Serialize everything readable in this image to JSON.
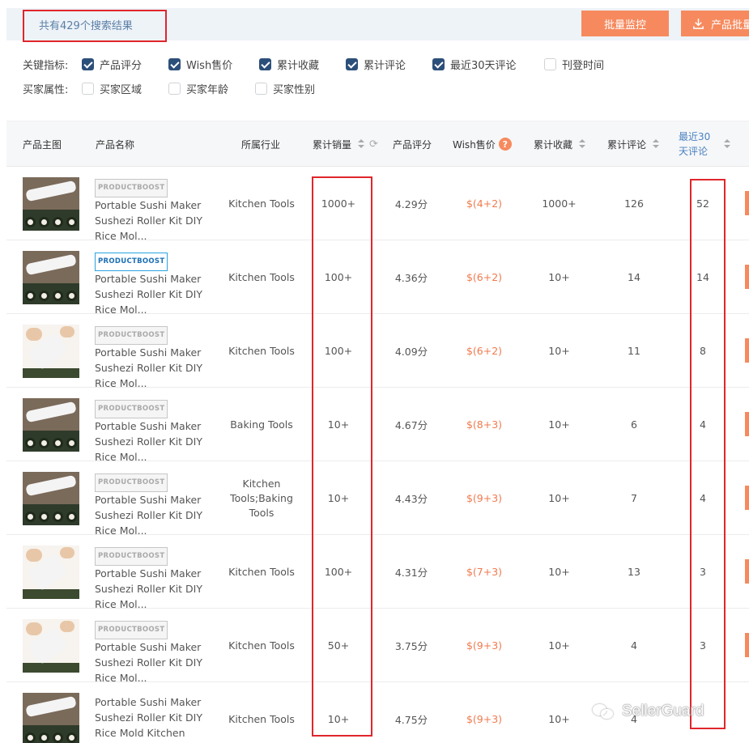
{
  "header": {
    "result_count": "共有429个搜索结果",
    "monitor_button": "批量监控",
    "export_button": "产品批量"
  },
  "filters": {
    "metrics_label": "关键指标:",
    "metrics": [
      {
        "label": "产品评分",
        "checked": true
      },
      {
        "label": "Wish售价",
        "checked": true
      },
      {
        "label": "累计收藏",
        "checked": true
      },
      {
        "label": "累计评论",
        "checked": true
      },
      {
        "label": "最近30天评论",
        "checked": true
      },
      {
        "label": "刊登时间",
        "checked": false
      }
    ],
    "buyer_label": "买家属性:",
    "buyer": [
      {
        "label": "买家区域",
        "checked": false
      },
      {
        "label": "买家年龄",
        "checked": false
      },
      {
        "label": "买家性别",
        "checked": false
      }
    ]
  },
  "columns": {
    "image": "产品主图",
    "name": "产品名称",
    "industry": "所属行业",
    "sales": "累计销量",
    "score": "产品评分",
    "price": "Wish售价",
    "favorites": "累计收藏",
    "reviews": "累计评论",
    "recent_reviews": "最近30天评论"
  },
  "badge_text": "PRODUCTBOOST",
  "rows": [
    {
      "badge": true,
      "badge_highlight": false,
      "name": "Portable Sushi Maker Sushezi Roller Kit DIY Rice Mol...",
      "industry": "Kitchen Tools",
      "sales": "1000+",
      "score": "4.29分",
      "price": "$(4+2)",
      "favorites": "1000+",
      "reviews": "126",
      "recent_reviews": "52",
      "thumb": "sushi"
    },
    {
      "badge": true,
      "badge_highlight": true,
      "name": "Portable Sushi Maker Sushezi Roller Kit DIY Rice Mol...",
      "industry": "Kitchen Tools",
      "sales": "100+",
      "score": "4.36分",
      "price": "$(6+2)",
      "favorites": "10+",
      "reviews": "14",
      "recent_reviews": "14",
      "thumb": "sushi"
    },
    {
      "badge": true,
      "badge_highlight": false,
      "name": "Portable Sushi Maker Sushezi Roller Kit DIY Rice Mol...",
      "industry": "Kitchen Tools",
      "sales": "100+",
      "score": "4.09分",
      "price": "$(6+2)",
      "favorites": "10+",
      "reviews": "11",
      "recent_reviews": "8",
      "thumb": "hands"
    },
    {
      "badge": true,
      "badge_highlight": false,
      "name": "Portable Sushi Maker Sushezi Roller Kit DIY Rice Mol...",
      "industry": "Baking Tools",
      "sales": "10+",
      "score": "4.67分",
      "price": "$(8+3)",
      "favorites": "10+",
      "reviews": "6",
      "recent_reviews": "4",
      "thumb": "sushi"
    },
    {
      "badge": true,
      "badge_highlight": false,
      "name": "Portable Sushi Maker Sushezi Roller Kit DIY Rice Mol...",
      "industry": "Kitchen Tools;Baking Tools",
      "sales": "10+",
      "score": "4.43分",
      "price": "$(9+3)",
      "favorites": "10+",
      "reviews": "7",
      "recent_reviews": "4",
      "thumb": "sushi"
    },
    {
      "badge": true,
      "badge_highlight": false,
      "name": "Portable Sushi Maker Sushezi Roller Kit DIY Rice Mol...",
      "industry": "Kitchen Tools",
      "sales": "100+",
      "score": "4.31分",
      "price": "$(7+3)",
      "favorites": "10+",
      "reviews": "13",
      "recent_reviews": "3",
      "thumb": "hands"
    },
    {
      "badge": true,
      "badge_highlight": false,
      "name": "Portable Sushi Maker Sushezi Roller Kit DIY Rice Mol...",
      "industry": "Kitchen Tools",
      "sales": "50+",
      "score": "3.75分",
      "price": "$(9+3)",
      "favorites": "10+",
      "reviews": "4",
      "recent_reviews": "3",
      "thumb": "hands"
    },
    {
      "badge": false,
      "badge_highlight": false,
      "name": "Portable Sushi Maker Sushezi Roller Kit DIY Rice Mold Kitchen Too...",
      "industry": "Kitchen Tools",
      "sales": "10+",
      "score": "4.75分",
      "price": "$(9+3)",
      "favorites": "10+",
      "reviews": "4",
      "recent_reviews": "",
      "thumb": "sushi"
    }
  ],
  "watermark": "SellerGuard",
  "colors": {
    "accent": "#f68a5e",
    "checkbox": "#2c4f7a",
    "highlight_box": "#e0262b",
    "price": "#f07a4e"
  }
}
